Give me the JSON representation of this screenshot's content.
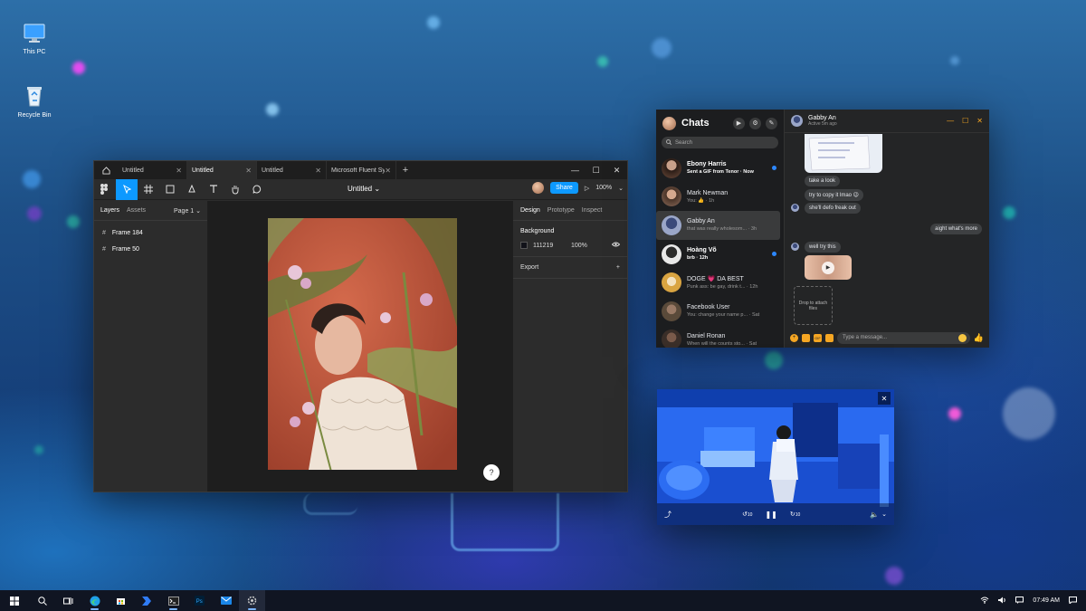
{
  "desktop": {
    "icons": [
      {
        "label": "This PC",
        "icon": "monitor-icon"
      },
      {
        "label": "Recycle Bin",
        "icon": "recycle-bin-icon"
      }
    ]
  },
  "figma": {
    "tabs": [
      {
        "label": "Untitled",
        "active": false
      },
      {
        "label": "Untitled",
        "active": true
      },
      {
        "label": "Untitled",
        "active": false
      },
      {
        "label": "Microsoft Fluent Syste",
        "active": false
      }
    ],
    "doc_title": "Untitled ⌄",
    "share_label": "Share",
    "zoom": "100%",
    "left_tabs": {
      "layers": "Layers",
      "assets": "Assets",
      "page": "Page 1 ⌄"
    },
    "layers": [
      "Frame 184",
      "Frame 50"
    ],
    "right_tabs": {
      "design": "Design",
      "prototype": "Prototype",
      "inspect": "Inspect"
    },
    "background": {
      "title": "Background",
      "hex": "111219",
      "opacity": "100%",
      "color": "#111219"
    },
    "export_label": "Export",
    "help": "?"
  },
  "chats": {
    "title": "Chats",
    "search_placeholder": "Search",
    "conversations": [
      {
        "name": "Ebony Harris",
        "preview": "Sent a GIF from Tenor · Now",
        "unread": true,
        "color": "#6b4a3a"
      },
      {
        "name": "Mark Newman",
        "preview": "You: 👍 · 1h",
        "unread": false,
        "color": "#8a6a5a"
      },
      {
        "name": "Gabby An",
        "preview": "that was really wholesom... · 3h",
        "unread": false,
        "selected": true,
        "color": "#9aa6c8"
      },
      {
        "name": "Hoàng Võ",
        "preview": "brb · 12h",
        "unread": true,
        "color": "#e8e8e8"
      },
      {
        "name": "DOGE 💗 DA BEST",
        "preview": "Punk ass: be gay, drink t... · 12h",
        "unread": false,
        "color": "#d9a441"
      },
      {
        "name": "Facebook User",
        "preview": "You: change your name p... · Sat",
        "unread": false,
        "color": "#5a4a3a"
      },
      {
        "name": "Daniel Ronan",
        "preview": "When will the counts sto... · Sat",
        "unread": false,
        "color": "#3a2e28"
      }
    ],
    "active_chat": {
      "name": "Gabby An",
      "status": "Active 5m ago",
      "messages": [
        "take a look",
        "try to copy it lmao 😉",
        "she'll defo freak out",
        "aight what's more",
        "well try this"
      ],
      "drop_text": "Drop to attach files",
      "input_placeholder": "Type a message..."
    }
  },
  "video": {
    "skip_back": "10",
    "skip_fwd": "10"
  },
  "taskbar": {
    "time": "07:49 AM"
  },
  "colors": {
    "figma_accent": "#0d99ff",
    "messenger_accent": "#f5a623",
    "unread_dot": "#2d88ff"
  }
}
